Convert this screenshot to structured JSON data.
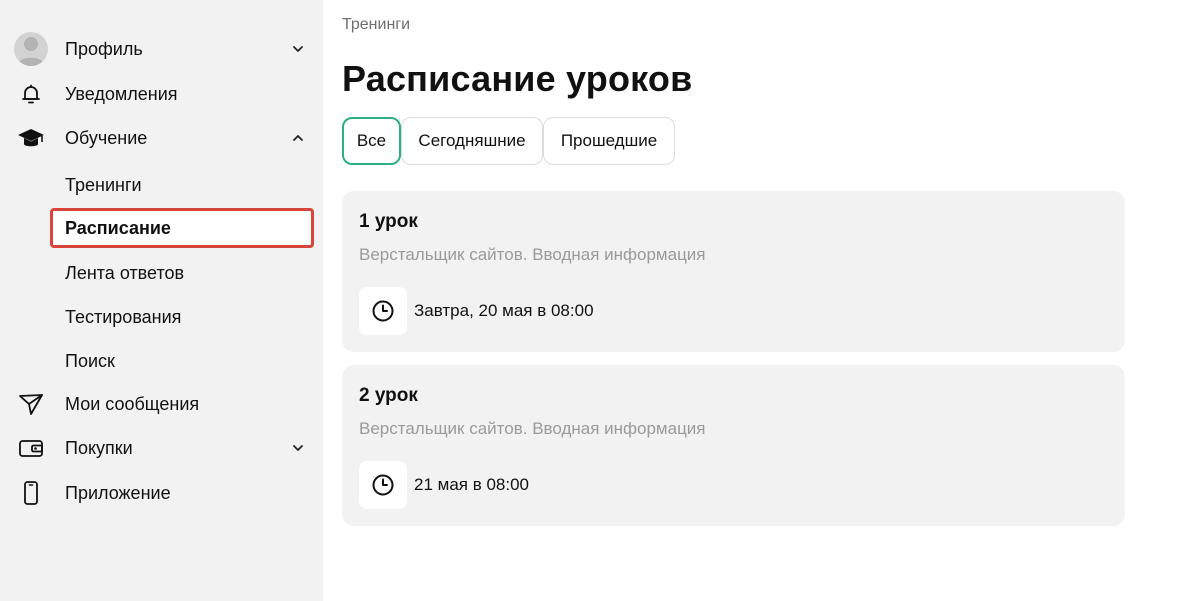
{
  "sidebar": {
    "profile": {
      "label": "Профиль",
      "icon": "avatar-icon"
    },
    "notifications": {
      "label": "Уведомления",
      "icon": "bell-icon"
    },
    "learning": {
      "label": "Обучение",
      "icon": "graduation-cap-icon",
      "expanded": true,
      "items": [
        {
          "label": "Тренинги"
        },
        {
          "label": "Расписание",
          "active": true
        },
        {
          "label": "Лента ответов"
        },
        {
          "label": "Тестирования"
        },
        {
          "label": "Поиск"
        }
      ]
    },
    "messages": {
      "label": "Мои сообщения",
      "icon": "send-icon"
    },
    "purchases": {
      "label": "Покупки",
      "icon": "wallet-icon"
    },
    "app": {
      "label": "Приложение",
      "icon": "phone-icon"
    }
  },
  "main": {
    "breadcrumb": "Тренинги",
    "title": "Расписание уроков",
    "tabs": [
      {
        "label": "Все",
        "active": true
      },
      {
        "label": "Сегодняшние"
      },
      {
        "label": "Прошедшие"
      }
    ],
    "lessons": [
      {
        "title": "1 урок",
        "subtitle": "Верстальщик сайтов. Вводная информация",
        "time": "Завтра, 20 мая в 08:00"
      },
      {
        "title": "2 урок",
        "subtitle": "Верстальщик сайтов. Вводная информация",
        "time": "21 мая в 08:00"
      }
    ]
  },
  "colors": {
    "sidebar_bg": "#f2f2f2",
    "active_tab_border": "#2bb07f",
    "highlight_border": "#d9443b",
    "muted_text": "#9a9a9a"
  }
}
